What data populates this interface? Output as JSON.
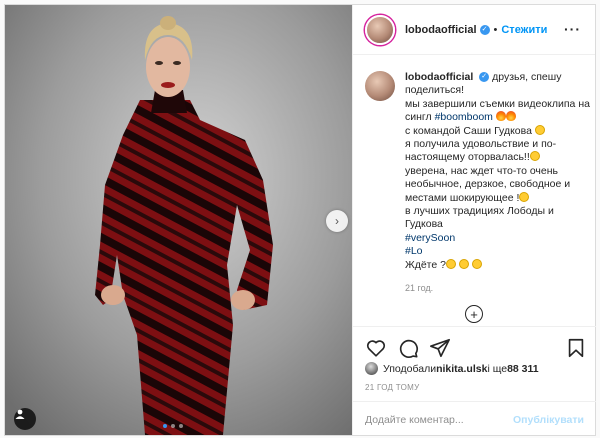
{
  "header": {
    "username": "lobodaofficial",
    "separator": "•",
    "follow_label": "Стежити",
    "more_label": "···"
  },
  "caption": {
    "username": "lobodaofficial",
    "line1": "друзья, спешу поделиться!",
    "line2": "мы завершили съемки видеоклипа на сингл ",
    "hashtag_boomboom": "#boomboom",
    "line3": "с командой Саши Гудкова ",
    "line4": "я получила удовольствие и по-настоящему оторвалась!!",
    "line5": "уверена, нас ждет что-то очень необычное, дерзкое, свободное и местами шокирующее !",
    "line6": "в лучших традициях Лободы и Гудкова",
    "hashtag_verysoon": "#verySoon",
    "hashtag_lo": "#Lo",
    "line7": "Ждёте ?",
    "time": "21 год."
  },
  "load_more_label": "+",
  "likes": {
    "prefix": "Уподобали ",
    "user": "nikita.ulsk",
    "middle": " і ще ",
    "count": "88 311"
  },
  "post_time": "21 ГОД ТОМУ",
  "comment": {
    "placeholder": "Додайте коментар...",
    "publish_label": "Опублікувати"
  },
  "media": {
    "next_label": "›"
  }
}
